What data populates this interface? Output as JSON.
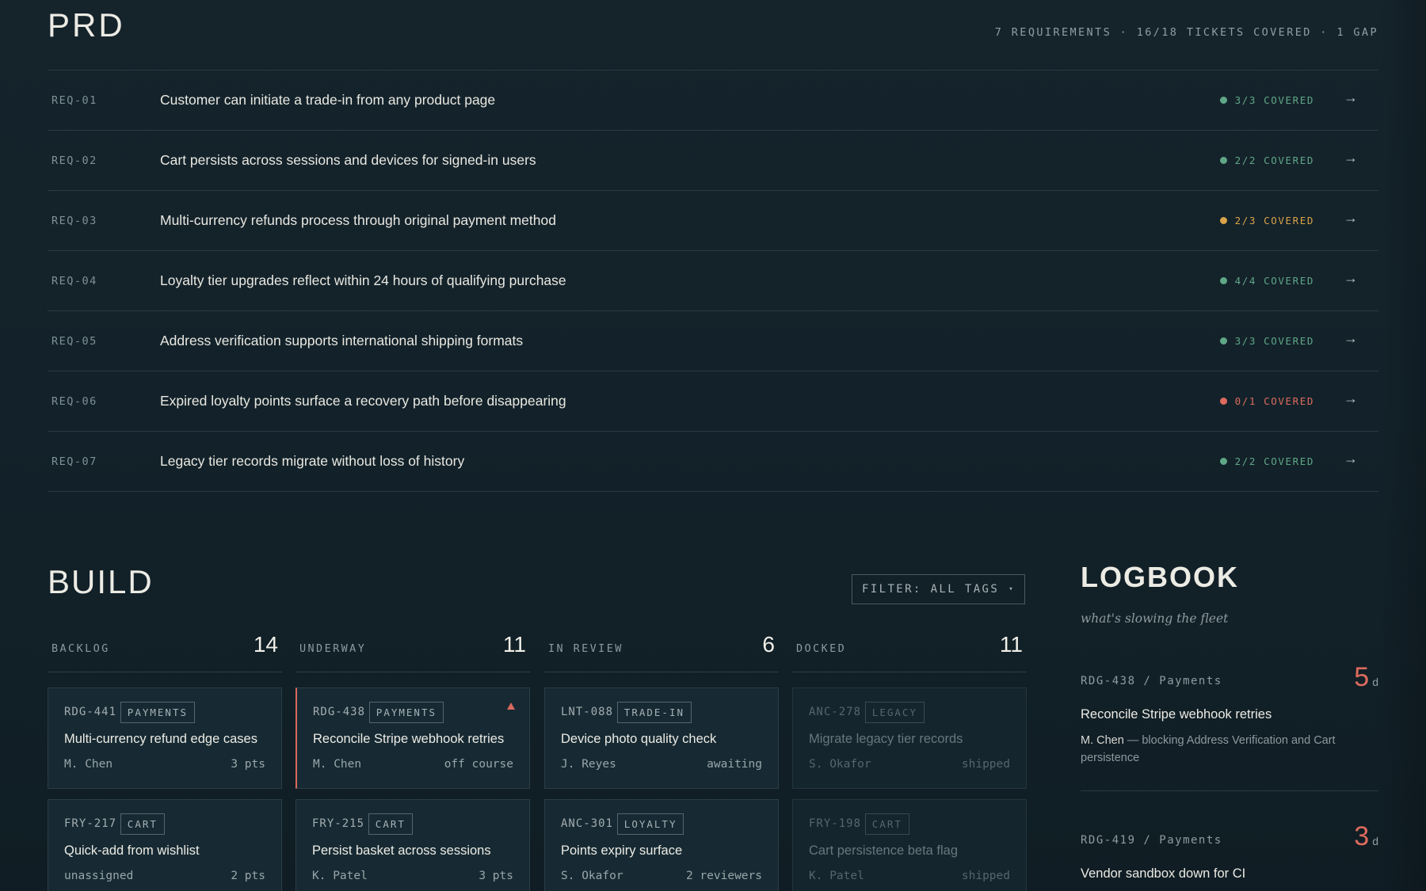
{
  "prd": {
    "title": "PRD",
    "summary": "7 REQUIREMENTS · 16/18 TICKETS COVERED · 1 GAP",
    "arrow": "→",
    "requirements": [
      {
        "id": "REQ-01",
        "text": "Customer can initiate a trade-in from any product page",
        "coverage": "3/3 COVERED",
        "status_color": "#5fa787"
      },
      {
        "id": "REQ-02",
        "text": "Cart persists across sessions and devices for signed-in users",
        "coverage": "2/2 COVERED",
        "status_color": "#5fa787"
      },
      {
        "id": "REQ-03",
        "text": "Multi-currency refunds process through original payment method",
        "coverage": "2/3 COVERED",
        "status_color": "#d9a348"
      },
      {
        "id": "REQ-04",
        "text": "Loyalty tier upgrades reflect within 24 hours of qualifying purchase",
        "coverage": "4/4 COVERED",
        "status_color": "#5fa787"
      },
      {
        "id": "REQ-05",
        "text": "Address verification supports international shipping formats",
        "coverage": "3/3 COVERED",
        "status_color": "#5fa787"
      },
      {
        "id": "REQ-06",
        "text": "Expired loyalty points surface a recovery path before disappearing",
        "coverage": "0/1 COVERED",
        "status_color": "#dd6b5e"
      },
      {
        "id": "REQ-07",
        "text": "Legacy tier records migrate without loss of history",
        "coverage": "2/2 COVERED",
        "status_color": "#5fa787"
      }
    ]
  },
  "build": {
    "title": "BUILD",
    "filter_label": "FILTER: ALL TAGS",
    "filter_caret": "▾",
    "columns": [
      {
        "label": "BACKLOG",
        "count": "14",
        "cards": [
          {
            "id": "RDG-441",
            "tag": "PAYMENTS",
            "title": "Multi-currency refund edge cases",
            "owner": "M. Chen",
            "meta": "3 pts"
          },
          {
            "id": "FRY-217",
            "tag": "CART",
            "title": "Quick-add from wishlist",
            "owner": "unassigned",
            "meta": "2 pts"
          }
        ]
      },
      {
        "label": "UNDERWAY",
        "count": "11",
        "cards": [
          {
            "id": "RDG-438",
            "tag": "PAYMENTS",
            "title": "Reconcile Stripe webhook retries",
            "owner": "M. Chen",
            "meta": "off course"
          },
          {
            "id": "FRY-215",
            "tag": "CART",
            "title": "Persist basket across sessions",
            "owner": "K. Patel",
            "meta": "3 pts"
          }
        ]
      },
      {
        "label": "IN REVIEW",
        "count": "6",
        "cards": [
          {
            "id": "LNT-088",
            "tag": "TRADE-IN",
            "title": "Device photo quality check",
            "owner": "J. Reyes",
            "meta": "awaiting"
          },
          {
            "id": "ANC-301",
            "tag": "LOYALTY",
            "title": "Points expiry surface",
            "owner": "S. Okafor",
            "meta": "2 reviewers"
          }
        ]
      },
      {
        "label": "DOCKED",
        "count": "11",
        "cards": [
          {
            "id": "ANC-278",
            "tag": "LEGACY",
            "title": "Migrate legacy tier records",
            "owner": "S. Okafor",
            "meta": "shipped"
          },
          {
            "id": "FRY-198",
            "tag": "CART",
            "title": "Cart persistence beta flag",
            "owner": "K. Patel",
            "meta": "shipped"
          }
        ]
      }
    ]
  },
  "logbook": {
    "title": "LOGBOOK",
    "subtitle": "what's slowing the fleet",
    "entries": [
      {
        "id": "RDG-438 / Payments",
        "days": "5",
        "unit": "d",
        "title": "Reconcile Stripe webhook retries",
        "who": "M. Chen",
        "desc": " — blocking Address Verification and Cart persistence"
      },
      {
        "id": "RDG-419 / Payments",
        "days": "3",
        "unit": "d",
        "title": "Vendor sandbox down for CI",
        "who": "",
        "desc": ""
      }
    ]
  },
  "colors": {
    "covered": "#5fa787",
    "partial": "#d9a348",
    "gap": "#dd6b5e",
    "background": "#13222a"
  }
}
